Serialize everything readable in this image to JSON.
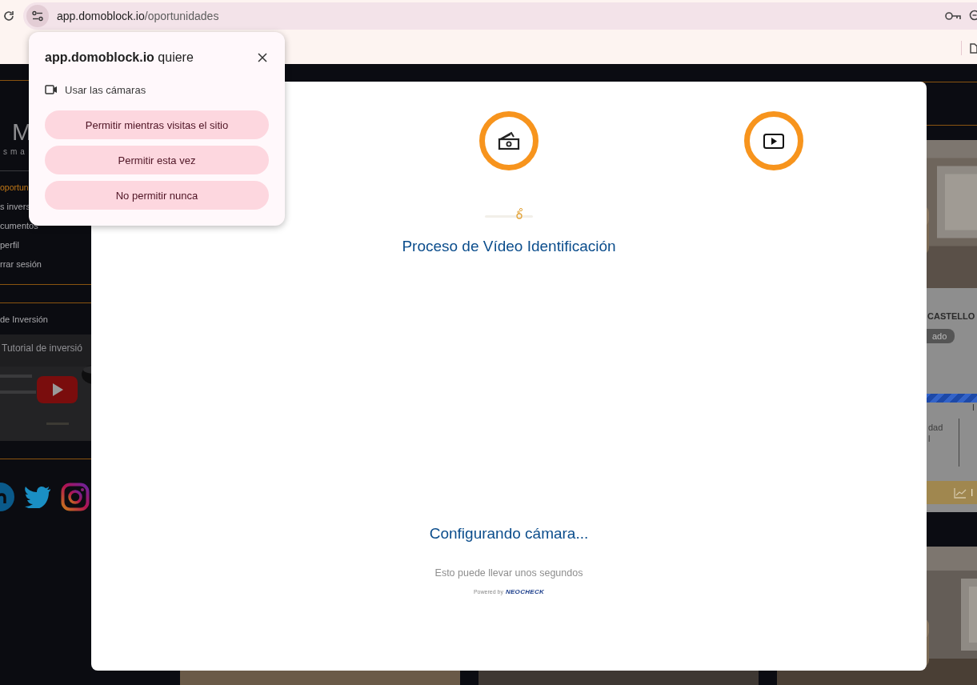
{
  "browser": {
    "url_host": "app.domoblock.io",
    "url_path": "/oportunidades"
  },
  "permission_prompt": {
    "title": "**app.domoblock.io** quiere",
    "permission": "Usar las cámaras",
    "buttons": [
      "Permitir mientras visitas el sitio",
      "Permitir esta vez",
      "No permitir nunca"
    ]
  },
  "sidebar": {
    "logo": "M",
    "tagline": "sma",
    "menu": [
      {
        "label": "oportun",
        "selected": true
      },
      {
        "label": "s invers",
        "selected": false
      },
      {
        "label": "cumentos",
        "selected": false
      },
      {
        "label": "perfil",
        "selected": false
      },
      {
        "label": "rrar sesión",
        "selected": false
      }
    ],
    "section_title": "de Inversión",
    "video": {
      "title": "Tutorial de inversió"
    }
  },
  "listing_card": {
    "title": "CASTELLO",
    "status": "ado",
    "progress": {
      "level": 1
    },
    "progress_label": "I",
    "metric_label": "dad",
    "metric_sub": "l",
    "button": "I"
  },
  "modal": {
    "steps": [
      {
        "kind": "money"
      },
      {
        "kind": "video"
      }
    ],
    "title": "Proceso de Vídeo Identificación",
    "status": "Configurando cámara...",
    "hint": "Esto puede llevar unos segundos",
    "powered_by": "Powered by",
    "brand": "NEOCHECK"
  }
}
